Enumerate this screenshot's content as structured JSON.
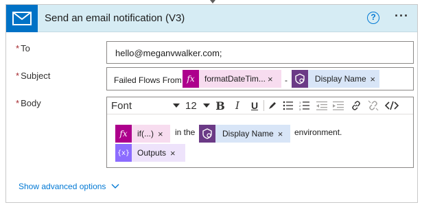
{
  "action": {
    "title": "Send an email notification (V3)",
    "icon": "envelope-icon",
    "help_label": "?",
    "more_label": "···"
  },
  "fields": {
    "to": {
      "label": "To",
      "required_mark": "*",
      "value": "hello@meganvwalker.com;"
    },
    "subject": {
      "label": "Subject",
      "required_mark": "*",
      "prefix": "Failed Flows From",
      "separator": "-",
      "tokens": [
        {
          "kind": "expression",
          "label": "formatDateTim...",
          "icon_text": "fx",
          "close": "×"
        },
        {
          "kind": "dynamic",
          "label": "Display Name",
          "icon": "dataverse-icon",
          "close": "×"
        }
      ]
    },
    "body": {
      "label": "Body",
      "required_mark": "*",
      "toolbar": {
        "font": "Font",
        "size": "12",
        "bold": "B",
        "italic": "I",
        "underline": "U"
      },
      "line1_text_in": "in the",
      "line1_text_env": "environment.",
      "tokens": [
        {
          "kind": "expression",
          "label": "if(...)",
          "icon_text": "fx",
          "close": "×"
        },
        {
          "kind": "dynamic",
          "label": "Display Name",
          "icon": "dataverse-icon",
          "close": "×"
        },
        {
          "kind": "variable",
          "label": "Outputs",
          "icon_text": "{x}",
          "close": "×"
        }
      ]
    }
  },
  "advanced_options": {
    "label": "Show advanced options"
  },
  "colors": {
    "header_bg": "#d6ecf4",
    "icon_bg": "#0072c6",
    "expression_token": "#f7dcef",
    "expression_icon": "#ad008c",
    "dynamic_token": "#d8e5f7",
    "dynamic_icon": "#6b3a86",
    "variable_token": "#eee3fb",
    "variable_icon": "#8c6cff",
    "link": "#0078d4",
    "required": "#a4262c"
  }
}
